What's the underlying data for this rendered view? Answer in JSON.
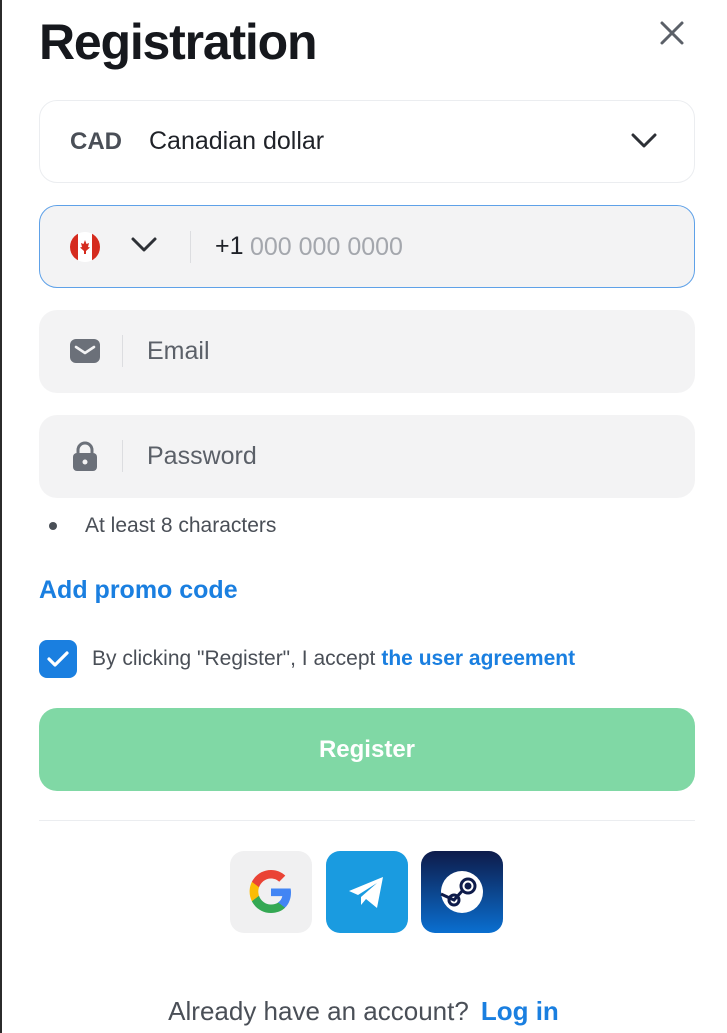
{
  "header": {
    "title": "Registration"
  },
  "currency": {
    "code": "CAD",
    "name": "Canadian dollar"
  },
  "phone": {
    "prefix": "+1",
    "placeholder": "000 000 0000",
    "country_flag": "canada-flag-icon",
    "focused_border_color": "#5ea1e8"
  },
  "email": {
    "placeholder": "Email"
  },
  "password": {
    "placeholder": "Password",
    "hint": "At least 8 characters"
  },
  "promo": {
    "label": "Add promo code"
  },
  "agreement": {
    "checked": true,
    "text": "By clicking \"Register\", I accept",
    "link": "the user agreement"
  },
  "register": {
    "label": "Register",
    "color": "#80d8a5"
  },
  "social": [
    "google-icon",
    "telegram-icon",
    "steam-icon"
  ],
  "footer": {
    "text": "Already have an account?",
    "link": "Log in"
  },
  "colors": {
    "accent": "#1a7fe0",
    "field_bg": "#f3f3f4"
  }
}
